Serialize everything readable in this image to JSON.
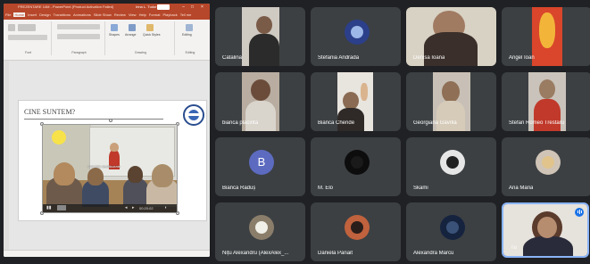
{
  "powerpoint": {
    "title": "PREZENTARE 14M - PowerPoint (Product Activation Failed)",
    "sign_in": "Irina L. Tudor",
    "tabs": [
      "File",
      "Home",
      "Insert",
      "Design",
      "Transitions",
      "Animations",
      "Slide Show",
      "Review",
      "View",
      "Help",
      "Format",
      "Playback",
      "Tell me"
    ],
    "active_tab": "Home",
    "ribbon_groups": [
      "Font",
      "Paragraph",
      "Drawing",
      "Editing"
    ],
    "ribbon_items": [
      "Shapes",
      "Arrange",
      "Quick Styles",
      "Editing"
    ],
    "slide": {
      "heading": "CINE SUNTEM?",
      "video_caption": "Activități desfășurate",
      "video_time": "00:20:02"
    }
  },
  "participants": [
    {
      "name": "Catalina",
      "kind": "camera"
    },
    {
      "name": "Stefania Andrada",
      "kind": "avatar-photo"
    },
    {
      "name": "Denisa Ioana",
      "kind": "camera"
    },
    {
      "name": "Angel Ioan",
      "kind": "avatar-photo"
    },
    {
      "name": "bianca placinta",
      "kind": "camera"
    },
    {
      "name": "Bianca Cheride",
      "kind": "camera"
    },
    {
      "name": "Georgiana Gavrila",
      "kind": "camera"
    },
    {
      "name": "Stefan Romeo Trestaru",
      "kind": "camera"
    },
    {
      "name": "Bianca Răduș",
      "kind": "avatar-letter",
      "letter": "B"
    },
    {
      "name": "M. Elo",
      "kind": "avatar-photo"
    },
    {
      "name": "Skami",
      "kind": "avatar-photo"
    },
    {
      "name": "Ana Maria",
      "kind": "avatar-photo"
    },
    {
      "name": "Nițu Alexandru (AlexAlex_...",
      "kind": "avatar-photo"
    },
    {
      "name": "Daniela Panait",
      "kind": "avatar-photo"
    },
    {
      "name": "Alexandra Marcu",
      "kind": "avatar-photo"
    },
    {
      "name": "Tu",
      "kind": "camera"
    }
  ],
  "colors": {
    "background": "#202124",
    "tile": "#3c4043",
    "ppt_accent": "#b7472a",
    "active_speaker": "#8ab4f8",
    "avatar_letter_bg": "#5c6bc0"
  }
}
